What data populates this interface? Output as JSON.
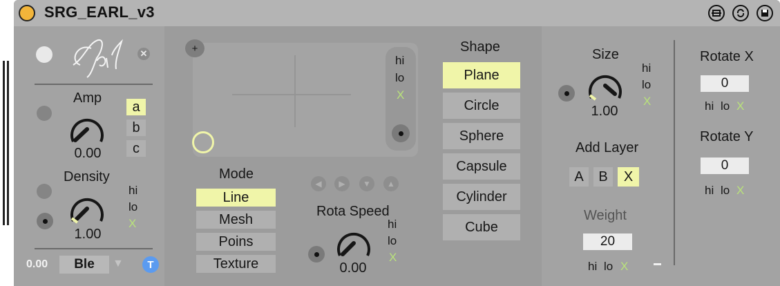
{
  "window": {
    "title": "SRG_EARL_v3"
  },
  "left": {
    "logo_text": "Earl",
    "amp": {
      "label": "Amp",
      "value": "0.00",
      "position": 0.0
    },
    "buttons_abc": [
      {
        "label": "a",
        "selected": true
      },
      {
        "label": "b",
        "selected": false
      },
      {
        "label": "c",
        "selected": false
      }
    ],
    "density": {
      "label": "Density",
      "value": "1.00",
      "position": 1.0
    },
    "density_range": {
      "hi": "hi",
      "lo": "lo",
      "x": "X"
    },
    "bottom": {
      "value": "0.00",
      "select": "Ble",
      "t_badge": "T"
    }
  },
  "mid": {
    "pad_plus": "+",
    "pad_range": {
      "hi": "hi",
      "lo": "lo",
      "x": "X"
    },
    "mode": {
      "label": "Mode",
      "options": [
        "Line",
        "Mesh",
        "Poins",
        "Texture"
      ],
      "selected": 0
    },
    "rota_speed": {
      "label": "Rota Speed",
      "value": "0.00",
      "position": 0.0
    },
    "rota_range": {
      "hi": "hi",
      "lo": "lo",
      "x": "X"
    },
    "shape": {
      "label": "Shape",
      "options": [
        "Plane",
        "Circle",
        "Sphere",
        "Capsule",
        "Cylinder",
        "Cube"
      ],
      "selected": 0
    }
  },
  "right": {
    "size": {
      "label": "Size",
      "value": "1.00",
      "position": 1.0
    },
    "size_range": {
      "hi": "hi",
      "lo": "lo",
      "x": "X"
    },
    "add_layer": {
      "label": "Add Layer",
      "options": [
        "A",
        "B",
        "X"
      ],
      "selected": 2
    },
    "weight": {
      "label": "Weight",
      "value": "20"
    },
    "weight_range": {
      "hi": "hi",
      "lo": "lo",
      "x": "X"
    },
    "dash": "-",
    "rotate_x": {
      "label": "Rotate X",
      "value": "0"
    },
    "rotate_x_range": {
      "hi": "hi",
      "lo": "lo",
      "x": "X"
    },
    "rotate_y": {
      "label": "Rotate Y",
      "value": "0"
    },
    "rotate_y_range": {
      "hi": "hi",
      "lo": "lo",
      "x": "X"
    }
  },
  "colors": {
    "accent_yellow": "#f0f5a9",
    "accent_green": "#b9e27b",
    "title_dot": "#f2b53a"
  }
}
